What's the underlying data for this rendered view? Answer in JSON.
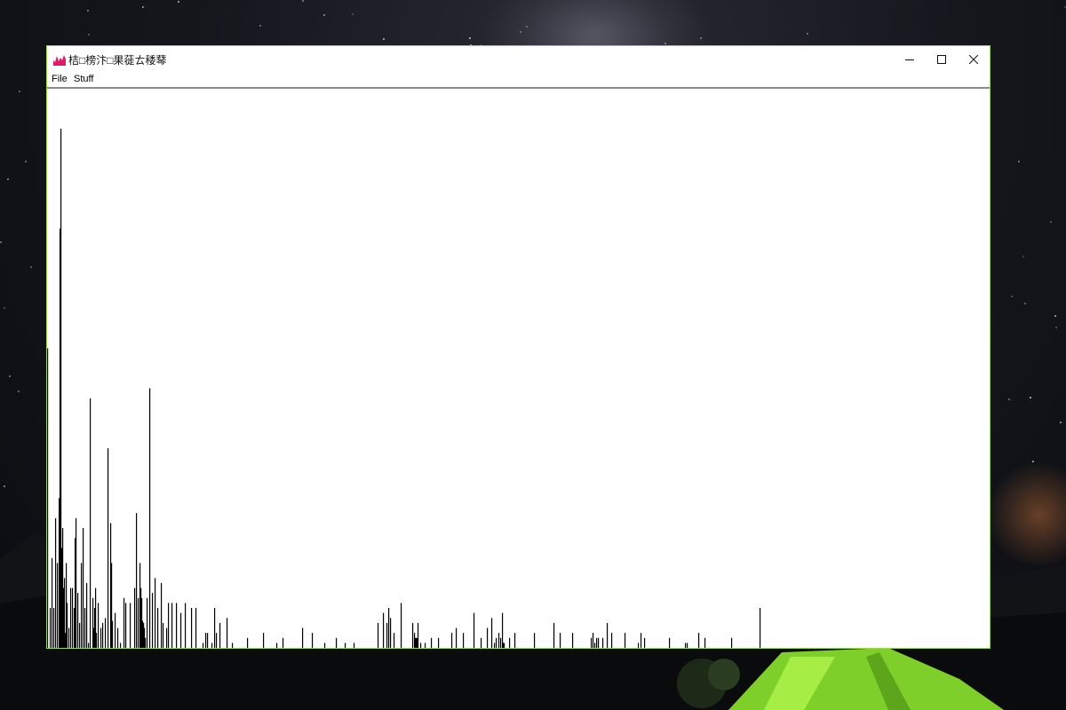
{
  "window": {
    "title": "桔□榜汴□果蓰ㄊ䅗䔷",
    "icon": "histogram-app-icon",
    "controls": [
      "minimize-icon",
      "maximize-icon",
      "close-icon"
    ]
  },
  "menu": {
    "items": [
      {
        "label": "File"
      },
      {
        "label": "Stuff"
      }
    ]
  },
  "chart_data": {
    "type": "bar",
    "bar_color": "#000000",
    "background": "#ffffff",
    "x": [
      0,
      3,
      5,
      7,
      9,
      11,
      13,
      14,
      15,
      16,
      17,
      18,
      19,
      20,
      21,
      22,
      24,
      26,
      28,
      30,
      31,
      32,
      34,
      36,
      38,
      40,
      42,
      44,
      46,
      48,
      51,
      52,
      53,
      54,
      55,
      57,
      60,
      62,
      65,
      68,
      71,
      72,
      73,
      76,
      79,
      82,
      86,
      88,
      93,
      98,
      100,
      102,
      104,
      105,
      106,
      107,
      108,
      109,
      110,
      112,
      115,
      118,
      121,
      124,
      128,
      130,
      134,
      136,
      140,
      145,
      150,
      155,
      162,
      167,
      175,
      178,
      180,
      185,
      188,
      190,
      194,
      202,
      208,
      225,
      243,
      258,
      265,
      287,
      298,
      312,
      325,
      335,
      345,
      372,
      378,
      382,
      384,
      386,
      390,
      398,
      411,
      413,
      414,
      415,
      416,
      417,
      420,
      425,
      432,
      440,
      455,
      460,
      468,
      480,
      488,
      495,
      500,
      503,
      505,
      508,
      510,
      512,
      513,
      514,
      520,
      526,
      548,
      570,
      577,
      591,
      612,
      614,
      616,
      618,
      620,
      625,
      630,
      635,
      650,
      665,
      668,
      672,
      700,
      718,
      720,
      733,
      740,
      770,
      802
    ],
    "values": [
      300,
      40,
      90,
      40,
      130,
      85,
      150,
      420,
      520,
      100,
      120,
      60,
      70,
      15,
      85,
      45,
      20,
      60,
      60,
      40,
      110,
      130,
      55,
      25,
      85,
      120,
      40,
      65,
      5,
      250,
      50,
      20,
      40,
      60,
      15,
      45,
      20,
      25,
      30,
      200,
      125,
      85,
      27,
      35,
      20,
      5,
      50,
      45,
      45,
      60,
      135,
      50,
      85,
      60,
      50,
      27,
      25,
      20,
      10,
      50,
      260,
      55,
      70,
      40,
      65,
      25,
      20,
      45,
      45,
      45,
      35,
      45,
      40,
      40,
      5,
      15,
      15,
      5,
      40,
      15,
      25,
      30,
      5,
      10,
      15,
      5,
      10,
      20,
      15,
      5,
      10,
      5,
      5,
      25,
      35,
      25,
      40,
      30,
      15,
      45,
      25,
      15,
      10,
      10,
      10,
      25,
      5,
      5,
      10,
      10,
      15,
      20,
      15,
      35,
      10,
      20,
      30,
      5,
      10,
      15,
      10,
      35,
      5,
      5,
      10,
      15,
      15,
      25,
      15,
      15,
      10,
      15,
      5,
      10,
      10,
      10,
      25,
      15,
      15,
      5,
      15,
      10,
      10,
      5,
      5,
      15,
      10,
      10,
      40
    ],
    "ylim": [
      0,
      560
    ],
    "xlim": [
      0,
      1061
    ]
  }
}
